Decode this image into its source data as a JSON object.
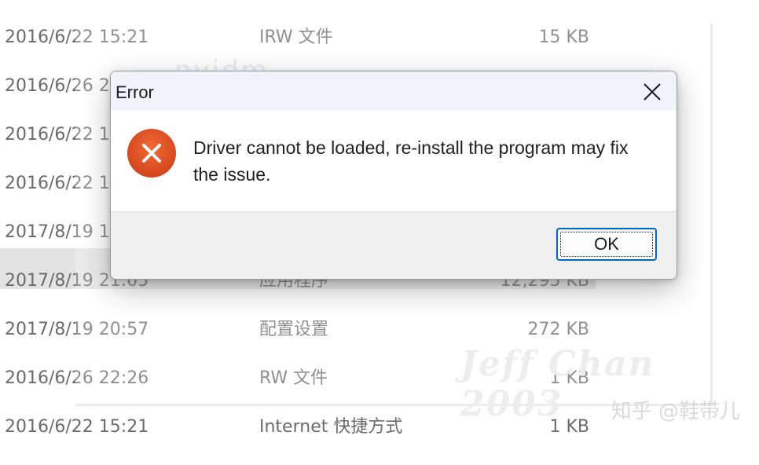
{
  "file_list": {
    "rows": [
      {
        "date": "2016/6/22 15:21",
        "type": "IRW 文件",
        "size": "15 KB"
      },
      {
        "date": "2016/6/26 2",
        "type": "",
        "size": ""
      },
      {
        "date": "2016/6/22 1",
        "type": "",
        "size": ""
      },
      {
        "date": "2016/6/22 1",
        "type": "",
        "size": ""
      },
      {
        "date": "2017/8/19 1",
        "type": "",
        "size": ""
      },
      {
        "date": "2017/8/19 21:05",
        "type": "应用程序",
        "size": "12,295 KB"
      },
      {
        "date": "2017/8/19 20:57",
        "type": "配置设置",
        "size": "272 KB"
      },
      {
        "date": "2016/6/26 22:26",
        "type": "RW 文件",
        "size": "1 KB"
      },
      {
        "date": "2016/6/22 15:21",
        "type": "Internet 快捷方式",
        "size": "1 KB"
      }
    ]
  },
  "watermarks": {
    "blurred_text": "nvidm",
    "signature": "Jeff Chan 2003",
    "source": "知乎 @鞋带儿"
  },
  "dialog": {
    "title": "Error",
    "message": "Driver cannot be loaded, re-install the program may fix the issue.",
    "ok_label": "OK",
    "icon": "error-icon",
    "close_icon": "close-icon"
  },
  "colors": {
    "error_icon": "#e04e1f",
    "focus_border": "#0067c0",
    "title_bar": "#f0f4fa",
    "footer": "#f0f0f0"
  }
}
